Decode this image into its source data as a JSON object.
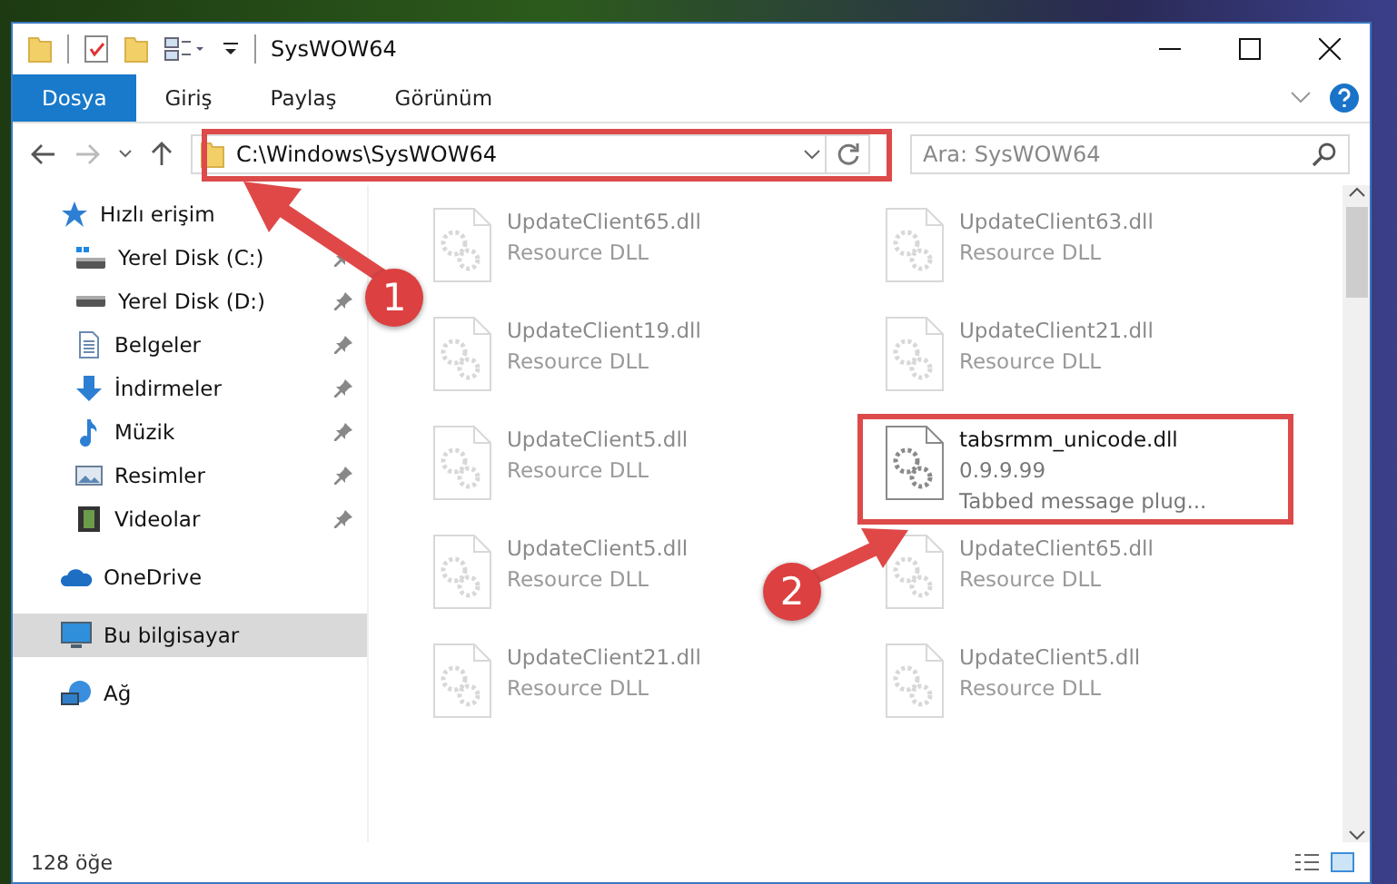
{
  "window": {
    "title": "SysWOW64"
  },
  "ribbon_tabs": [
    {
      "label": "Dosya",
      "selected": true
    },
    {
      "label": "Giriş",
      "selected": false
    },
    {
      "label": "Paylaş",
      "selected": false
    },
    {
      "label": "Görünüm",
      "selected": false
    }
  ],
  "address": {
    "value": "C:\\Windows\\SysWOW64"
  },
  "search": {
    "placeholder": "Ara: SysWOW64"
  },
  "sidebar": {
    "items": [
      {
        "label": "Hızlı erişim",
        "kind": "star",
        "selected": false,
        "children": [
          {
            "label": "Yerel Disk (C:)",
            "kind": "drive-c",
            "pinned": true,
            "selected": false
          },
          {
            "label": "Yerel Disk (D:)",
            "kind": "drive",
            "pinned": true,
            "selected": false
          },
          {
            "label": "Belgeler",
            "kind": "document",
            "pinned": true,
            "selected": false
          },
          {
            "label": "İndirmeler",
            "kind": "download",
            "pinned": true,
            "selected": false
          },
          {
            "label": "Müzik",
            "kind": "music",
            "pinned": true,
            "selected": false
          },
          {
            "label": "Resimler",
            "kind": "pictures",
            "pinned": true,
            "selected": false
          },
          {
            "label": "Videolar",
            "kind": "video",
            "pinned": true,
            "selected": false
          }
        ]
      },
      {
        "label": "OneDrive",
        "kind": "cloud",
        "selected": false
      },
      {
        "label": "Bu bilgisayar",
        "kind": "computer",
        "selected": true
      },
      {
        "label": "Ağ",
        "kind": "network",
        "selected": false
      }
    ]
  },
  "files": [
    {
      "name": "UpdateClient65.dll",
      "details": [
        "Resource DLL"
      ],
      "faded": true
    },
    {
      "name": "UpdateClient63.dll",
      "details": [
        "Resource DLL"
      ],
      "faded": true
    },
    {
      "name": "UpdateClient19.dll",
      "details": [
        "Resource DLL"
      ],
      "faded": true
    },
    {
      "name": "UpdateClient21.dll",
      "details": [
        "Resource DLL"
      ],
      "faded": true
    },
    {
      "name": "UpdateClient5.dll",
      "details": [
        "Resource DLL"
      ],
      "faded": true
    },
    {
      "name": "tabsrmm_unicode.dll",
      "details": [
        "0.9.9.99",
        "Tabbed message plug..."
      ],
      "faded": false
    },
    {
      "name": "UpdateClient5.dll",
      "details": [
        "Resource DLL"
      ],
      "faded": true
    },
    {
      "name": "UpdateClient65.dll",
      "details": [
        "Resource DLL"
      ],
      "faded": true
    },
    {
      "name": "UpdateClient21.dll",
      "details": [
        "Resource DLL"
      ],
      "faded": true
    },
    {
      "name": "UpdateClient5.dll",
      "details": [
        "Resource DLL"
      ],
      "faded": true
    }
  ],
  "status_bar": {
    "item_count": "128 öğe"
  },
  "callouts": [
    {
      "label": "1"
    },
    {
      "label": "2"
    }
  ]
}
